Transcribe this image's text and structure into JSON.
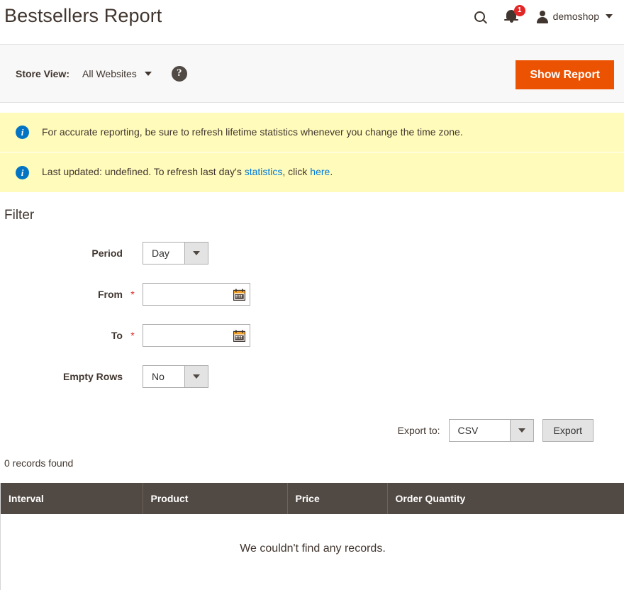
{
  "header": {
    "title": "Bestsellers Report",
    "search_icon": "search-icon",
    "notifications_icon": "bell-icon",
    "notifications_count": "1",
    "user_icon": "person-icon",
    "account_name": "demoshop",
    "account_caret": "chevron-down-icon"
  },
  "storeview": {
    "label": "Store View:",
    "selected": "All Websites",
    "caret": "chevron-down-icon",
    "help_icon": "?",
    "show_report_label": "Show Report"
  },
  "messages": [
    {
      "icon": "i",
      "text": "For accurate reporting, be sure to refresh lifetime statistics whenever you change the time zone."
    },
    {
      "icon": "i",
      "prefix": "Last updated: undefined. To refresh last day's ",
      "link1": "statistics",
      "middle": ", click ",
      "link2": "here",
      "suffix": "."
    }
  ],
  "filter": {
    "title": "Filter",
    "period": {
      "label": "Period",
      "value": "Day"
    },
    "from": {
      "label": "From",
      "required": "*",
      "value": "",
      "placeholder": ""
    },
    "to": {
      "label": "To",
      "required": "*",
      "value": "",
      "placeholder": ""
    },
    "empty_rows": {
      "label": "Empty Rows",
      "value": "No"
    }
  },
  "export": {
    "label": "Export to:",
    "format": "CSV",
    "button_label": "Export"
  },
  "grid": {
    "records_found": "0 records found",
    "columns": [
      "Interval",
      "Product",
      "Price",
      "Order Quantity"
    ],
    "empty_message": "We couldn't find any records."
  },
  "colors": {
    "accent_orange": "#eb5202",
    "message_bg": "#fffbbb",
    "grid_header_bg": "#514943",
    "link_blue": "#007bdb",
    "info_blue": "#0374c4",
    "badge_red": "#e22626",
    "text_dark": "#41362f"
  }
}
